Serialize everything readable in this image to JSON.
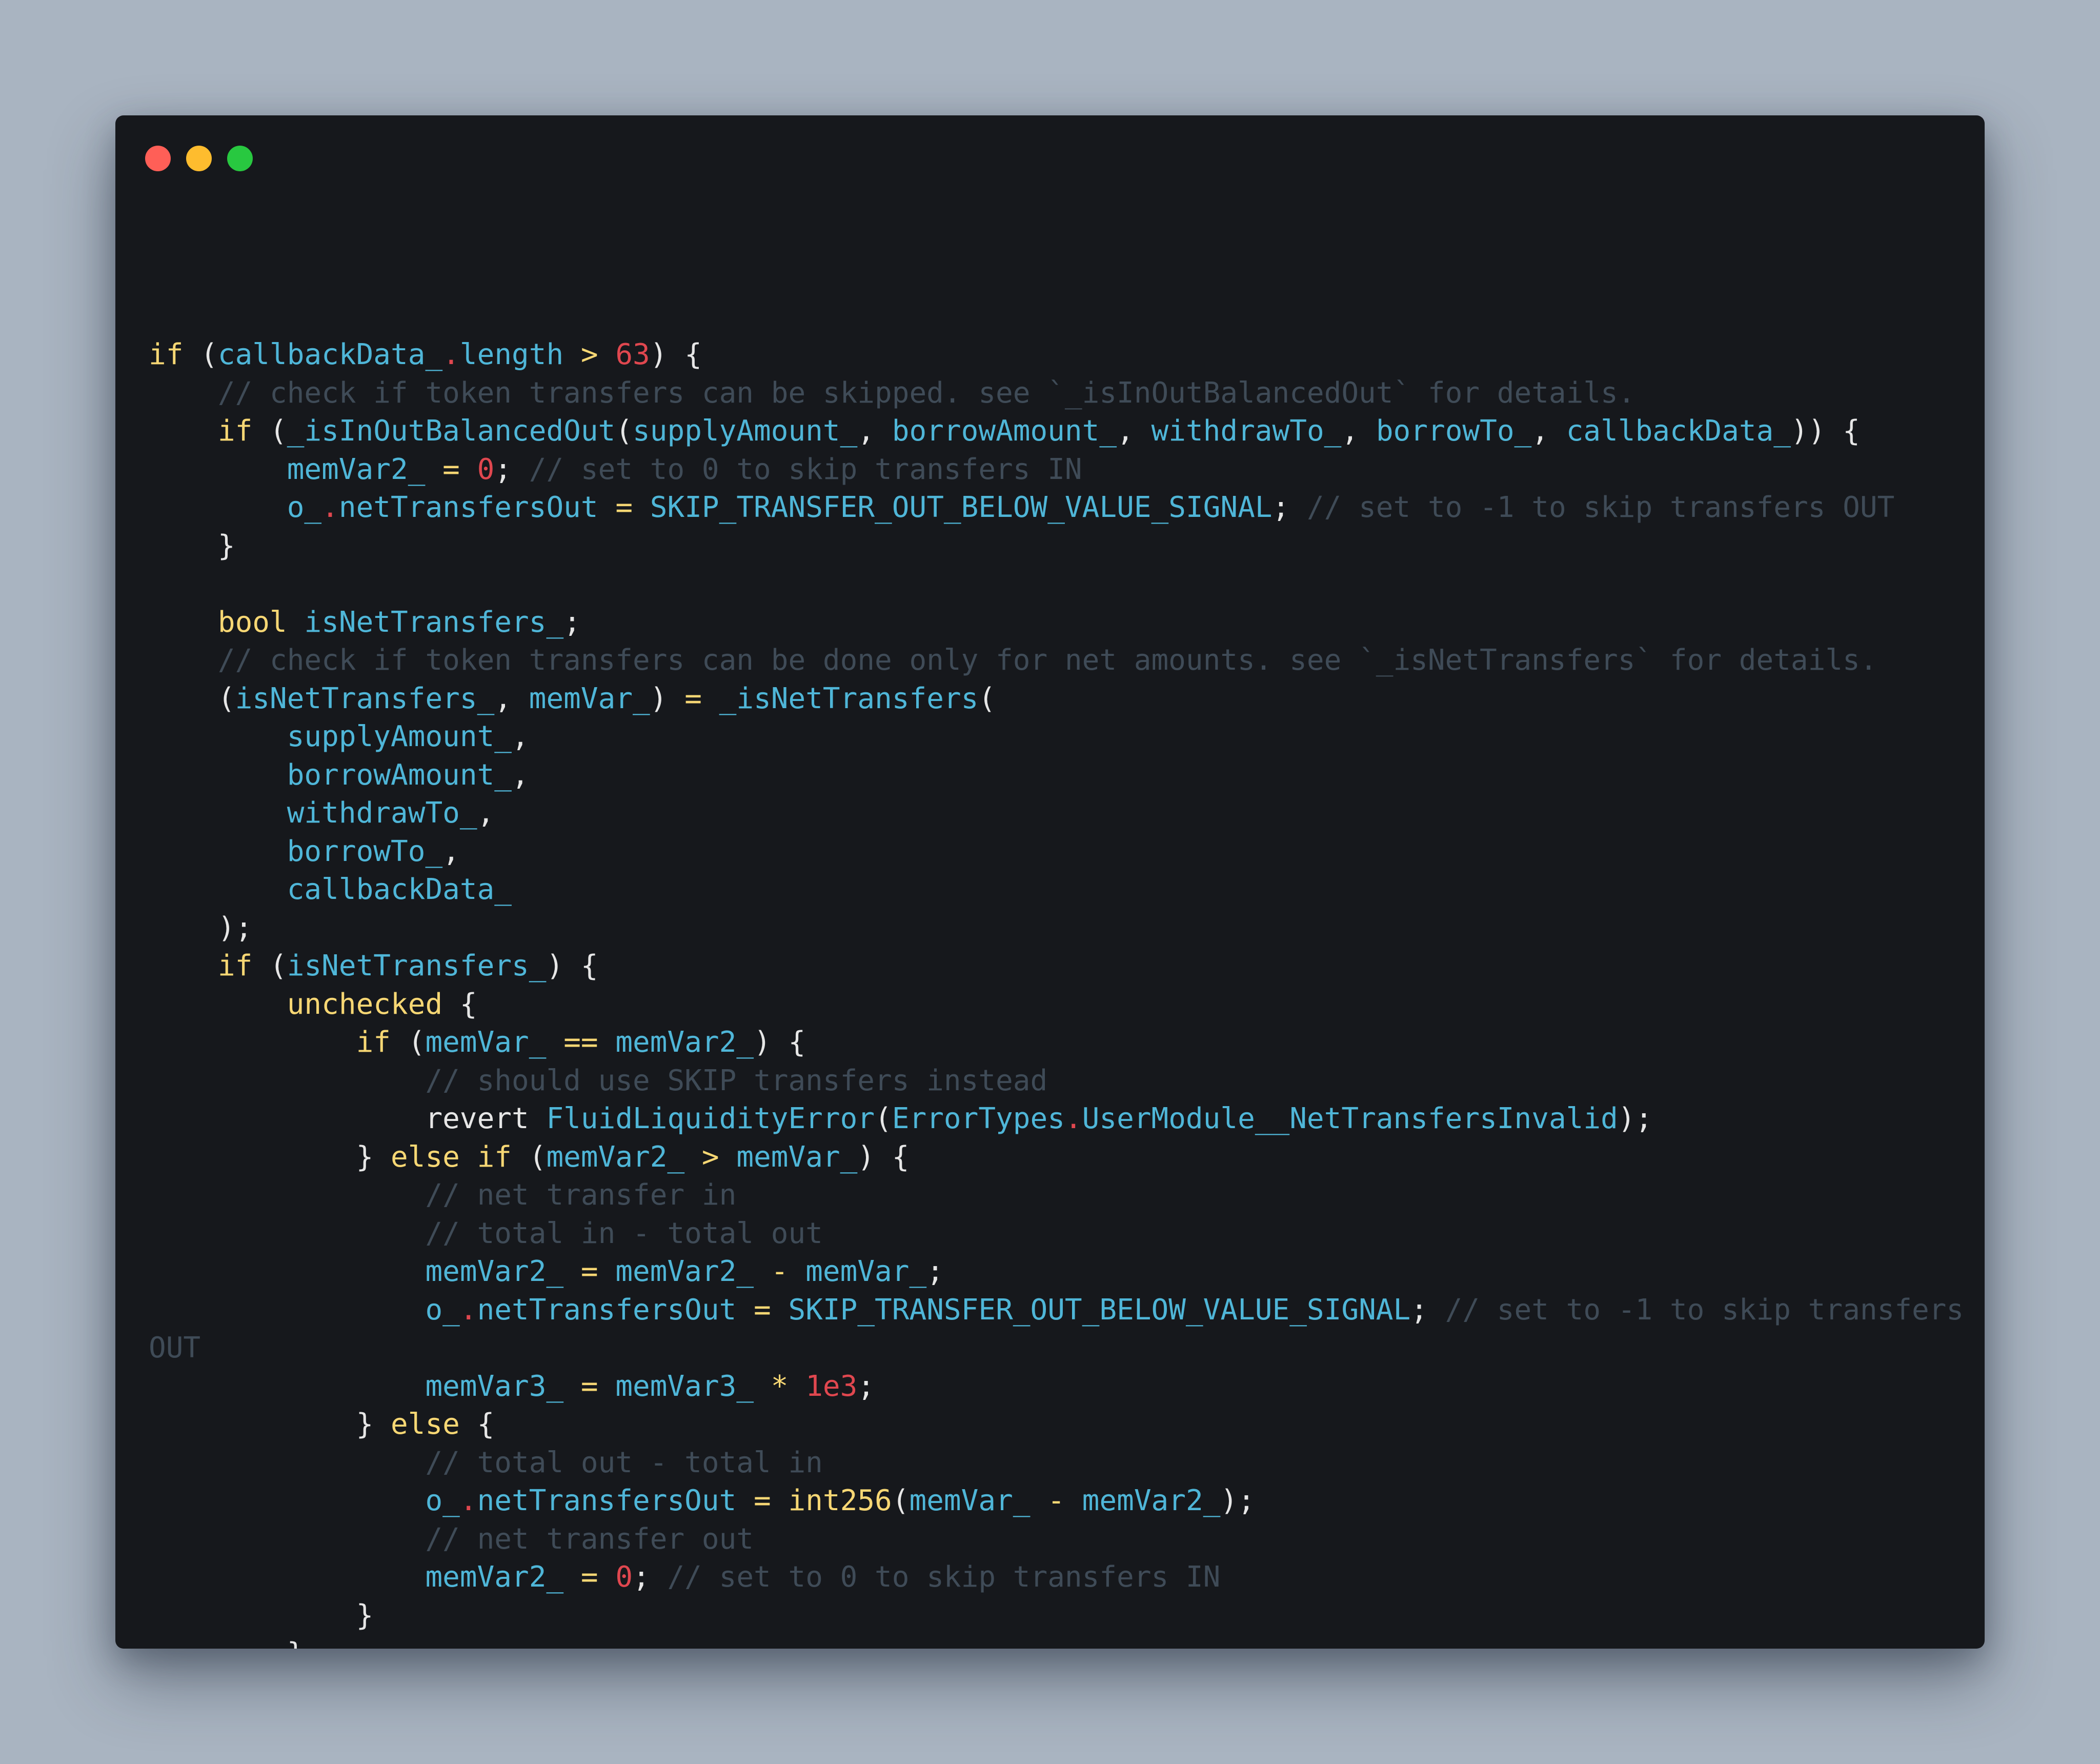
{
  "theme": {
    "background": "#a9b4c1",
    "window_background": "#16181c",
    "traffic_lights": {
      "close": "#ff5f57",
      "minimize": "#febc2e",
      "zoom": "#28c840"
    },
    "token_colors": {
      "keyword": "#f7d774",
      "ident": "#4fb6d8",
      "number": "#e0474f",
      "comment": "#3f4b57",
      "op": "#f7d774",
      "dot": "#e0474f",
      "punct": "#e6e6e6",
      "plain": "#e6e6e6"
    }
  },
  "code_lines": [
    [
      [
        "keyword",
        "if"
      ],
      [
        "punct",
        " ("
      ],
      [
        "ident",
        "callbackData_"
      ],
      [
        "dot",
        "."
      ],
      [
        "ident",
        "length"
      ],
      [
        "punct",
        " "
      ],
      [
        "op",
        ">"
      ],
      [
        "punct",
        " "
      ],
      [
        "number",
        "63"
      ],
      [
        "punct",
        ") {"
      ]
    ],
    [
      [
        "punct",
        "    "
      ],
      [
        "comment",
        "// check if token transfers can be skipped. see `_isInOutBalancedOut` for details."
      ]
    ],
    [
      [
        "punct",
        "    "
      ],
      [
        "keyword",
        "if"
      ],
      [
        "punct",
        " ("
      ],
      [
        "ident",
        "_isInOutBalancedOut"
      ],
      [
        "punct",
        "("
      ],
      [
        "ident",
        "supplyAmount_"
      ],
      [
        "punct",
        ", "
      ],
      [
        "ident",
        "borrowAmount_"
      ],
      [
        "punct",
        ", "
      ],
      [
        "ident",
        "withdrawTo_"
      ],
      [
        "punct",
        ", "
      ],
      [
        "ident",
        "borrowTo_"
      ],
      [
        "punct",
        ", "
      ],
      [
        "ident",
        "callbackData_"
      ],
      [
        "punct",
        ")) {"
      ]
    ],
    [
      [
        "punct",
        "        "
      ],
      [
        "ident",
        "memVar2_"
      ],
      [
        "punct",
        " "
      ],
      [
        "op",
        "="
      ],
      [
        "punct",
        " "
      ],
      [
        "number",
        "0"
      ],
      [
        "punct",
        "; "
      ],
      [
        "comment",
        "// set to 0 to skip transfers IN"
      ]
    ],
    [
      [
        "punct",
        "        "
      ],
      [
        "ident",
        "o_"
      ],
      [
        "dot",
        "."
      ],
      [
        "ident",
        "netTransfersOut"
      ],
      [
        "punct",
        " "
      ],
      [
        "op",
        "="
      ],
      [
        "punct",
        " "
      ],
      [
        "ident",
        "SKIP_TRANSFER_OUT_BELOW_VALUE_SIGNAL"
      ],
      [
        "punct",
        "; "
      ],
      [
        "comment",
        "// set to -1 to skip transfers OUT"
      ]
    ],
    [
      [
        "punct",
        "    }"
      ]
    ],
    [],
    [
      [
        "punct",
        "    "
      ],
      [
        "keyword",
        "bool"
      ],
      [
        "punct",
        " "
      ],
      [
        "ident",
        "isNetTransfers_"
      ],
      [
        "punct",
        ";"
      ]
    ],
    [
      [
        "punct",
        "    "
      ],
      [
        "comment",
        "// check if token transfers can be done only for net amounts. see `_isNetTransfers` for details."
      ]
    ],
    [
      [
        "punct",
        "    ("
      ],
      [
        "ident",
        "isNetTransfers_"
      ],
      [
        "punct",
        ", "
      ],
      [
        "ident",
        "memVar_"
      ],
      [
        "punct",
        ") "
      ],
      [
        "op",
        "="
      ],
      [
        "punct",
        " "
      ],
      [
        "ident",
        "_isNetTransfers"
      ],
      [
        "punct",
        "("
      ]
    ],
    [
      [
        "punct",
        "        "
      ],
      [
        "ident",
        "supplyAmount_"
      ],
      [
        "punct",
        ","
      ]
    ],
    [
      [
        "punct",
        "        "
      ],
      [
        "ident",
        "borrowAmount_"
      ],
      [
        "punct",
        ","
      ]
    ],
    [
      [
        "punct",
        "        "
      ],
      [
        "ident",
        "withdrawTo_"
      ],
      [
        "punct",
        ","
      ]
    ],
    [
      [
        "punct",
        "        "
      ],
      [
        "ident",
        "borrowTo_"
      ],
      [
        "punct",
        ","
      ]
    ],
    [
      [
        "punct",
        "        "
      ],
      [
        "ident",
        "callbackData_"
      ]
    ],
    [
      [
        "punct",
        "    );"
      ]
    ],
    [
      [
        "punct",
        "    "
      ],
      [
        "keyword",
        "if"
      ],
      [
        "punct",
        " ("
      ],
      [
        "ident",
        "isNetTransfers_"
      ],
      [
        "punct",
        ") {"
      ]
    ],
    [
      [
        "punct",
        "        "
      ],
      [
        "keyword",
        "unchecked"
      ],
      [
        "punct",
        " {"
      ]
    ],
    [
      [
        "punct",
        "            "
      ],
      [
        "keyword",
        "if"
      ],
      [
        "punct",
        " ("
      ],
      [
        "ident",
        "memVar_"
      ],
      [
        "punct",
        " "
      ],
      [
        "op",
        "=="
      ],
      [
        "punct",
        " "
      ],
      [
        "ident",
        "memVar2_"
      ],
      [
        "punct",
        ") {"
      ]
    ],
    [
      [
        "punct",
        "                "
      ],
      [
        "comment",
        "// should use SKIP transfers instead"
      ]
    ],
    [
      [
        "punct",
        "                "
      ],
      [
        "plain",
        "revert"
      ],
      [
        "punct",
        " "
      ],
      [
        "ident",
        "FluidLiquidityError"
      ],
      [
        "punct",
        "("
      ],
      [
        "ident",
        "ErrorTypes"
      ],
      [
        "dot",
        "."
      ],
      [
        "ident",
        "UserModule__NetTransfersInvalid"
      ],
      [
        "punct",
        ");"
      ]
    ],
    [
      [
        "punct",
        "            } "
      ],
      [
        "keyword",
        "else"
      ],
      [
        "punct",
        " "
      ],
      [
        "keyword",
        "if"
      ],
      [
        "punct",
        " ("
      ],
      [
        "ident",
        "memVar2_"
      ],
      [
        "punct",
        " "
      ],
      [
        "op",
        ">"
      ],
      [
        "punct",
        " "
      ],
      [
        "ident",
        "memVar_"
      ],
      [
        "punct",
        ") {"
      ]
    ],
    [
      [
        "punct",
        "                "
      ],
      [
        "comment",
        "// net transfer in"
      ]
    ],
    [
      [
        "punct",
        "                "
      ],
      [
        "comment",
        "// total in - total out"
      ]
    ],
    [
      [
        "punct",
        "                "
      ],
      [
        "ident",
        "memVar2_"
      ],
      [
        "punct",
        " "
      ],
      [
        "op",
        "="
      ],
      [
        "punct",
        " "
      ],
      [
        "ident",
        "memVar2_"
      ],
      [
        "punct",
        " "
      ],
      [
        "op",
        "-"
      ],
      [
        "punct",
        " "
      ],
      [
        "ident",
        "memVar_"
      ],
      [
        "punct",
        ";"
      ]
    ],
    [
      [
        "punct",
        "                "
      ],
      [
        "ident",
        "o_"
      ],
      [
        "dot",
        "."
      ],
      [
        "ident",
        "netTransfersOut"
      ],
      [
        "punct",
        " "
      ],
      [
        "op",
        "="
      ],
      [
        "punct",
        " "
      ],
      [
        "ident",
        "SKIP_TRANSFER_OUT_BELOW_VALUE_SIGNAL"
      ],
      [
        "punct",
        "; "
      ],
      [
        "comment",
        "// set to -1 to skip transfers"
      ]
    ],
    [
      [
        "comment",
        "OUT"
      ]
    ],
    [
      [
        "punct",
        "                "
      ],
      [
        "ident",
        "memVar3_"
      ],
      [
        "punct",
        " "
      ],
      [
        "op",
        "="
      ],
      [
        "punct",
        " "
      ],
      [
        "ident",
        "memVar3_"
      ],
      [
        "punct",
        " "
      ],
      [
        "op",
        "*"
      ],
      [
        "punct",
        " "
      ],
      [
        "number",
        "1e3"
      ],
      [
        "punct",
        ";"
      ]
    ],
    [
      [
        "punct",
        "            } "
      ],
      [
        "keyword",
        "else"
      ],
      [
        "punct",
        " {"
      ]
    ],
    [
      [
        "punct",
        "                "
      ],
      [
        "comment",
        "// total out - total in"
      ]
    ],
    [
      [
        "punct",
        "                "
      ],
      [
        "ident",
        "o_"
      ],
      [
        "dot",
        "."
      ],
      [
        "ident",
        "netTransfersOut"
      ],
      [
        "punct",
        " "
      ],
      [
        "op",
        "="
      ],
      [
        "punct",
        " "
      ],
      [
        "keyword",
        "int256"
      ],
      [
        "punct",
        "("
      ],
      [
        "ident",
        "memVar_"
      ],
      [
        "punct",
        " "
      ],
      [
        "op",
        "-"
      ],
      [
        "punct",
        " "
      ],
      [
        "ident",
        "memVar2_"
      ],
      [
        "punct",
        ");"
      ]
    ],
    [
      [
        "punct",
        "                "
      ],
      [
        "comment",
        "// net transfer out"
      ]
    ],
    [
      [
        "punct",
        "                "
      ],
      [
        "ident",
        "memVar2_"
      ],
      [
        "punct",
        " "
      ],
      [
        "op",
        "="
      ],
      [
        "punct",
        " "
      ],
      [
        "number",
        "0"
      ],
      [
        "punct",
        "; "
      ],
      [
        "comment",
        "// set to 0 to skip transfers IN"
      ]
    ],
    [
      [
        "punct",
        "            }"
      ]
    ],
    [
      [
        "punct",
        "        }"
      ]
    ],
    [
      [
        "punct",
        "    }"
      ]
    ],
    [
      [
        "punct",
        "}"
      ]
    ]
  ]
}
